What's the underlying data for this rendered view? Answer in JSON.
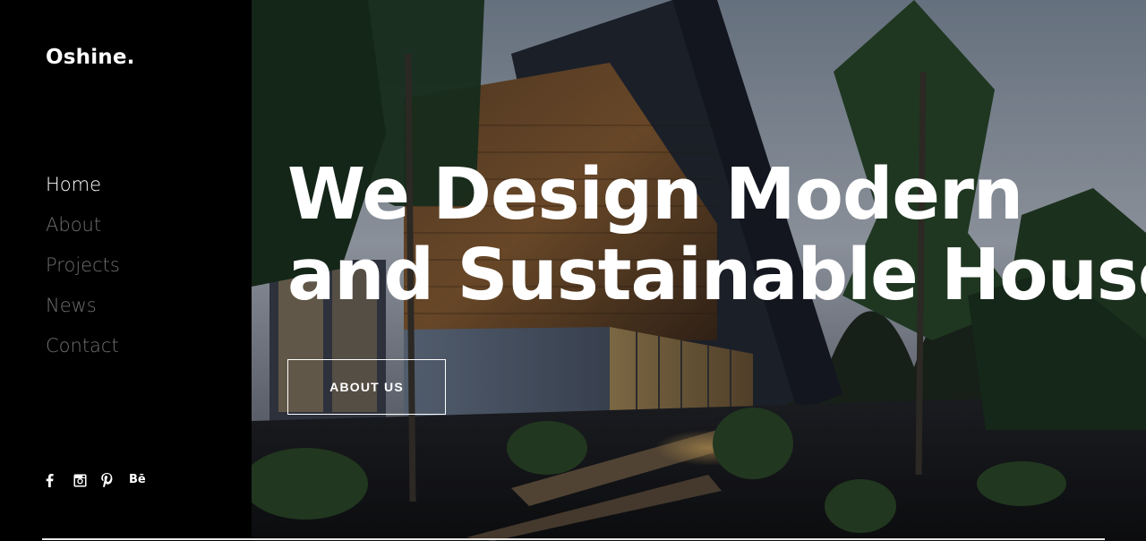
{
  "brand": {
    "logo": "Oshine."
  },
  "nav": {
    "items": [
      {
        "label": "Home",
        "active": true
      },
      {
        "label": "About",
        "active": false
      },
      {
        "label": "Projects",
        "active": false
      },
      {
        "label": "News",
        "active": false
      },
      {
        "label": "Contact",
        "active": false
      }
    ]
  },
  "social": {
    "icons": [
      "facebook-icon",
      "instagram-icon",
      "pinterest-icon",
      "behance-icon"
    ],
    "behance_label": "Bē"
  },
  "hero": {
    "title_line1": "We Design Modern",
    "title_line2": "and Sustainable Houses",
    "button_label": "ABOUT US"
  },
  "colors": {
    "sidebar_bg": "#000000",
    "nav_active": "#ffffff",
    "nav_inactive": "#6f6f6f",
    "text": "#ffffff"
  }
}
